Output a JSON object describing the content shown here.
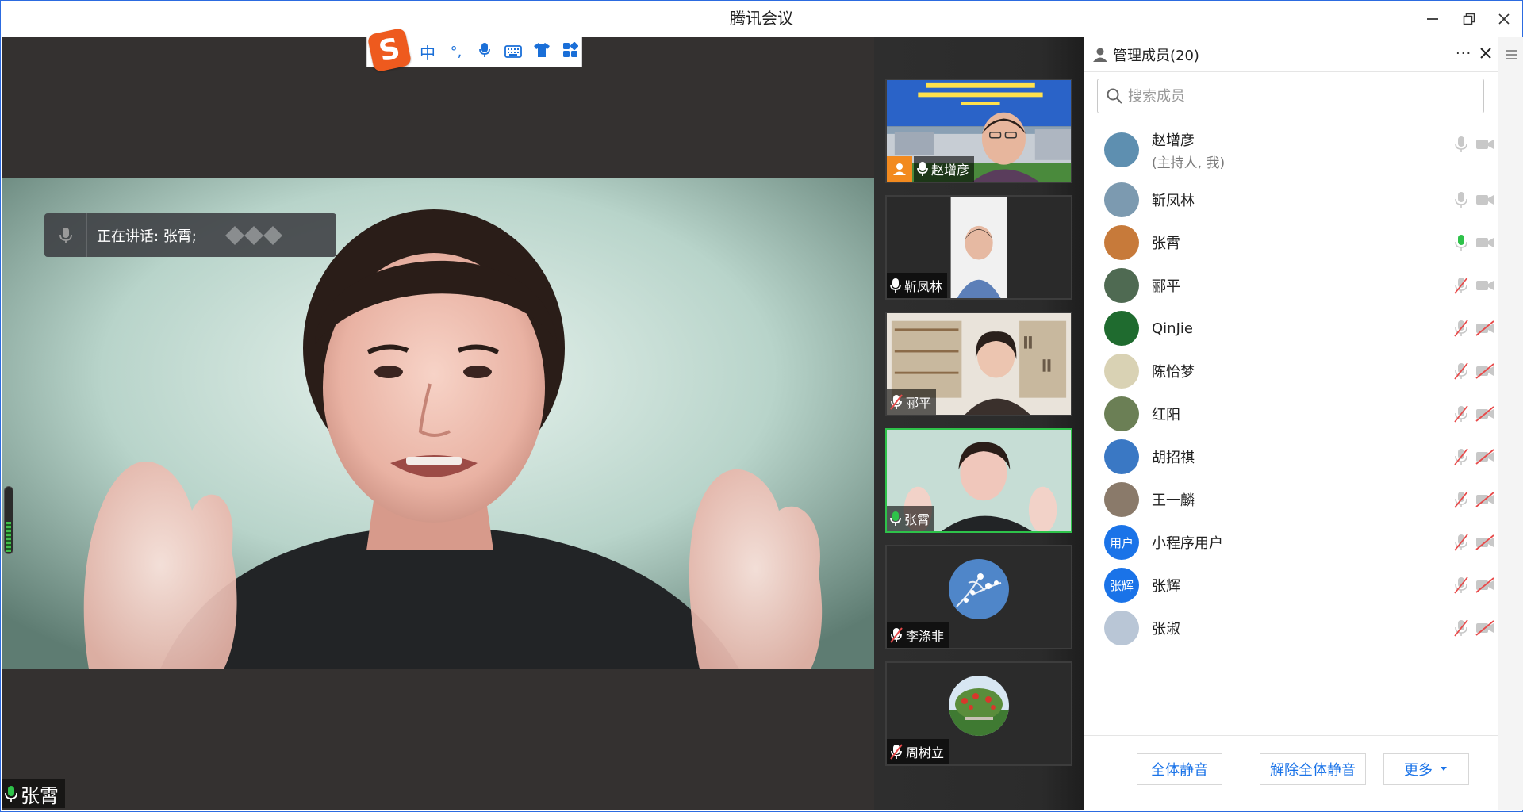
{
  "window": {
    "title": "腾讯会议"
  },
  "ime_toolbar": {
    "logo": "S",
    "items": [
      "中",
      "°,",
      "mic-icon",
      "keyboard-icon",
      "shirt-icon",
      "grid-icon"
    ],
    "lang_label": "中",
    "punct_label": "°,"
  },
  "main_video": {
    "speaking_label": "正在讲话: 张霄;",
    "self_name": "张霄",
    "volume_level": 0.45
  },
  "gallery": {
    "tiles": [
      {
        "name": "赵增彦",
        "mic": "on",
        "host": true,
        "active": false
      },
      {
        "name": "靳凤林",
        "mic": "on",
        "host": false,
        "active": false
      },
      {
        "name": "郦平",
        "mic": "muted",
        "host": false,
        "active": false
      },
      {
        "name": "张霄",
        "mic": "speaking",
        "host": false,
        "active": true
      },
      {
        "name": "李涤非",
        "mic": "muted",
        "host": false,
        "active": false
      },
      {
        "name": "周树立",
        "mic": "muted",
        "host": false,
        "active": false
      }
    ]
  },
  "panel": {
    "title": "管理成员(20)",
    "more_label": "···",
    "search_placeholder": "搜索成员",
    "members": [
      {
        "name": "赵增彦",
        "sub": "(主持人, 我)",
        "mic": "on",
        "cam": "on",
        "avatar_text": ""
      },
      {
        "name": "靳凤林",
        "sub": "",
        "mic": "on",
        "cam": "on",
        "avatar_text": ""
      },
      {
        "name": "张霄",
        "sub": "",
        "mic": "speaking",
        "cam": "on",
        "avatar_text": ""
      },
      {
        "name": "郦平",
        "sub": "",
        "mic": "muted",
        "cam": "on",
        "avatar_text": ""
      },
      {
        "name": "QinJie",
        "sub": "",
        "mic": "muted",
        "cam": "off",
        "avatar_text": ""
      },
      {
        "name": "陈怡梦",
        "sub": "",
        "mic": "muted",
        "cam": "off",
        "avatar_text": ""
      },
      {
        "name": "红阳",
        "sub": "",
        "mic": "muted",
        "cam": "off",
        "avatar_text": ""
      },
      {
        "name": "胡招祺",
        "sub": "",
        "mic": "muted",
        "cam": "off",
        "avatar_text": ""
      },
      {
        "name": "王一麟",
        "sub": "",
        "mic": "muted",
        "cam": "off",
        "avatar_text": ""
      },
      {
        "name": "小程序用户",
        "sub": "",
        "mic": "muted",
        "cam": "off",
        "avatar_text": "用户"
      },
      {
        "name": "张辉",
        "sub": "",
        "mic": "muted",
        "cam": "off",
        "avatar_text": "张辉"
      },
      {
        "name": "张淑",
        "sub": "",
        "mic": "muted",
        "cam": "off",
        "avatar_text": ""
      }
    ],
    "footer": {
      "mute_all": "全体静音",
      "unmute_all": "解除全体静音",
      "more": "更多"
    }
  },
  "colors": {
    "accent": "#1a73e8",
    "speaking_green": "#2ec24a",
    "muted_red": "#e84a4a",
    "host_orange": "#f28a1f"
  }
}
